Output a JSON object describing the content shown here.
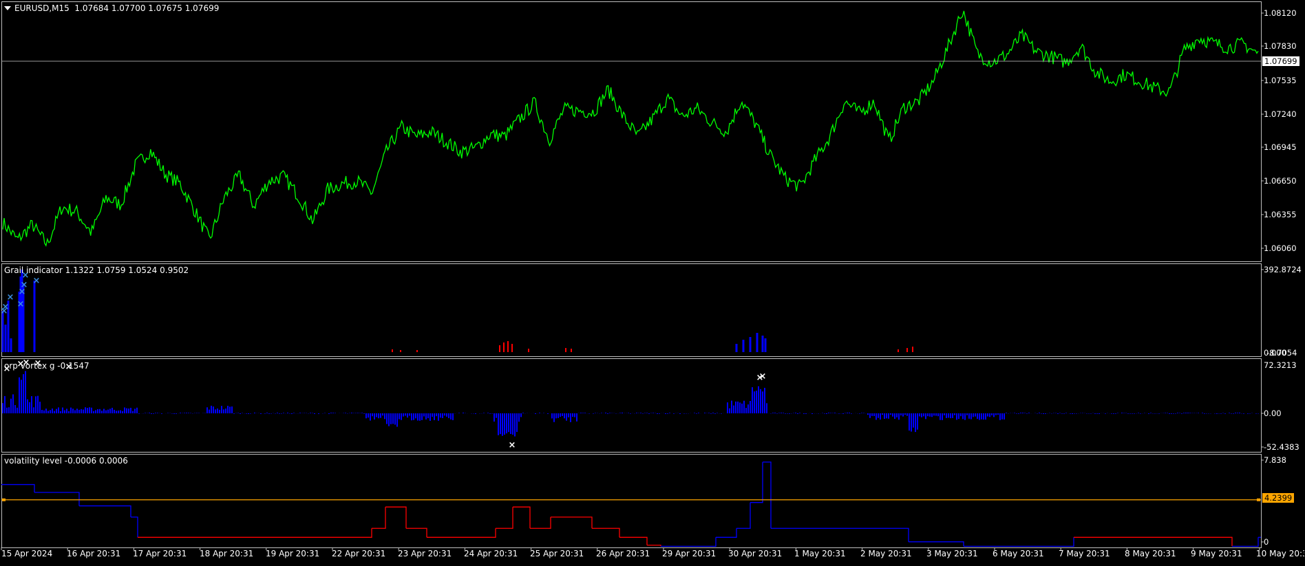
{
  "symbol_title": "EURUSD,M15  1.07684 1.07700 1.07675 1.07699",
  "main_price_scale": [
    "1.08120",
    "1.07830",
    "1.07535",
    "1.07240",
    "1.06945",
    "1.06650",
    "1.06355",
    "1.06060"
  ],
  "current_price": "1.07699",
  "indicators": {
    "grail": {
      "title": "Grail indicator 1.1322 1.0759 1.0524 0.9502",
      "scale_top": "392.8724",
      "scale_bottom": "0.000",
      "scale_bottom2": "-8.7054"
    },
    "orp": {
      "title": "orp vortex g -0.1547",
      "scale_top": "72.3213",
      "scale_mid": "0.00",
      "scale_bottom": "-52.4383"
    },
    "volatility": {
      "title": "volatility level -0.0006 0.0006",
      "scale_top": "7.838",
      "level_value": "4.2399",
      "scale_bottom": "0"
    }
  },
  "time_axis": [
    "15 Apr 2024",
    "16 Apr 20:31",
    "17 Apr 20:31",
    "18 Apr 20:31",
    "19 Apr 20:31",
    "22 Apr 20:31",
    "23 Apr 20:31",
    "24 Apr 20:31",
    "25 Apr 20:31",
    "26 Apr 20:31",
    "29 Apr 20:31",
    "30 Apr 20:31",
    "1 May 20:31",
    "2 May 20:31",
    "3 May 20:31",
    "6 May 20:31",
    "7 May 20:31",
    "8 May 20:31",
    "9 May 20:31",
    "10 May 20:31"
  ],
  "colors": {
    "price_line": "#00ff00",
    "histogram_blue": "#0000ff",
    "histogram_red": "#ff0000",
    "marker_blue": "#3a8dde",
    "level_line": "#ffa500",
    "border": "#c0c0c0"
  },
  "chart_data": {
    "type": "line",
    "symbol": "EURUSD",
    "timeframe": "M15",
    "x": [
      "15 Apr",
      "16 Apr",
      "17 Apr",
      "18 Apr",
      "19 Apr",
      "22 Apr",
      "23 Apr",
      "24 Apr",
      "25 Apr",
      "26 Apr",
      "29 Apr",
      "30 Apr",
      "1 May",
      "2 May",
      "3 May",
      "6 May",
      "7 May",
      "8 May",
      "9 May",
      "10 May"
    ],
    "ylim": [
      1.0595,
      1.0815
    ],
    "price_path": [
      1.0627,
      1.0612,
      1.0625,
      1.0608,
      1.064,
      1.0636,
      1.0618,
      1.0648,
      1.0642,
      1.0676,
      1.0688,
      1.0668,
      1.066,
      1.0637,
      1.0612,
      1.0648,
      1.0667,
      1.0641,
      1.0662,
      1.0666,
      1.065,
      1.0628,
      1.0655,
      1.066,
      1.0662,
      1.0652,
      1.0688,
      1.0708,
      1.07,
      1.0704,
      1.0696,
      1.0687,
      1.069,
      1.0702,
      1.07,
      1.0715,
      1.0729,
      1.0697,
      1.0723,
      1.0722,
      1.0721,
      1.074,
      1.0717,
      1.07,
      1.0715,
      1.0733,
      1.0717,
      1.0724,
      1.0712,
      1.0704,
      1.0731,
      1.071,
      1.0683,
      1.0664,
      1.0657,
      1.068,
      1.07,
      1.073,
      1.072,
      1.073,
      1.0696,
      1.0725,
      1.073,
      1.0747,
      1.0776,
      1.0808,
      1.077,
      1.0763,
      1.077,
      1.0786,
      1.0772,
      1.0768,
      1.0763,
      1.0777,
      1.0755,
      1.0747,
      1.0753,
      1.0747,
      1.0741,
      1.0738,
      1.0774,
      1.0784,
      1.0779,
      1.0776,
      1.0779,
      1.077
    ],
    "level_line": 4.2399
  }
}
